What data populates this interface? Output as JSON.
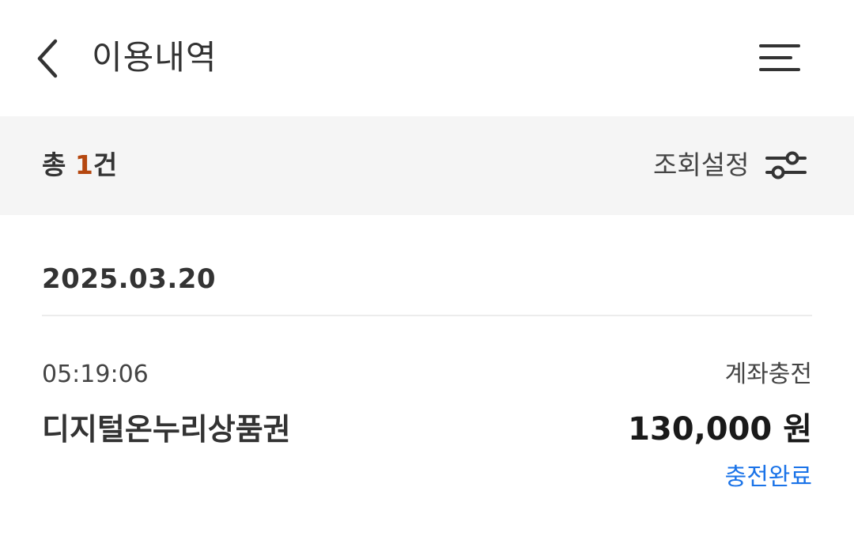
{
  "header": {
    "title": "이용내역",
    "back_icon": "chevron-left-icon",
    "menu_icon": "menu-icon"
  },
  "summary": {
    "total_prefix": "총 ",
    "total_count": "1",
    "total_suffix": "건",
    "filter_label": "조회설정",
    "filter_icon": "sliders-icon",
    "count_color": "#b5470f"
  },
  "groups": [
    {
      "date": "2025.03.20",
      "transactions": [
        {
          "time": "05:19:06",
          "type": "계좌충전",
          "name": "디지털온누리상품권",
          "amount": "130,000 원",
          "status": "충전완료",
          "status_color": "#1a73e8"
        }
      ]
    }
  ]
}
